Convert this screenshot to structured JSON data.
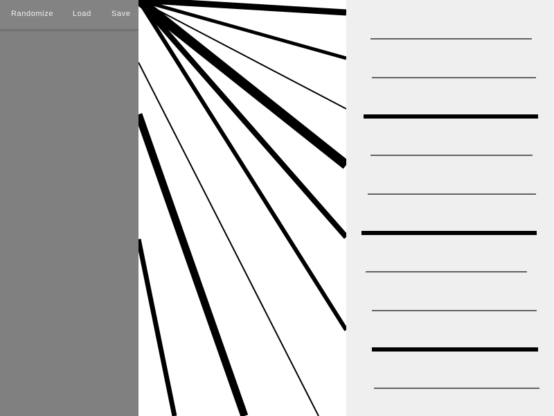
{
  "toolbar": {
    "randomize_label": "Randomize",
    "load_label": "Load",
    "save_label": "Save"
  },
  "colors": {
    "left_panel": "#808080",
    "toolbar": "#838383",
    "toolbar_text": "#f0f0f0",
    "canvas_bg": "#ffffff",
    "right_panel_bg": "#efefef",
    "stroke": "#000000",
    "thin_stroke": "#444444"
  }
}
